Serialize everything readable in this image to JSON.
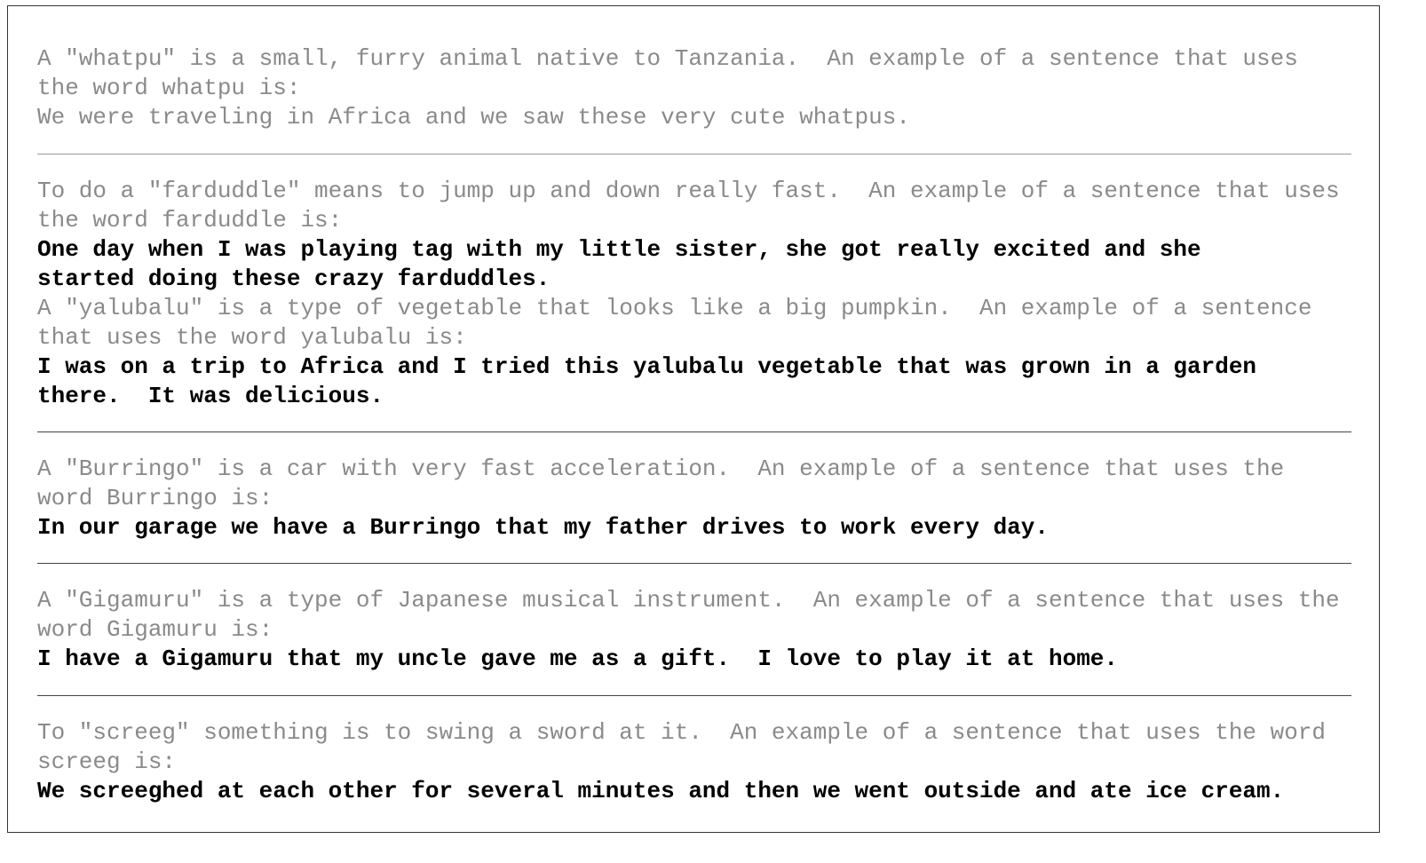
{
  "examples": [
    {
      "prompt_lines": [
        "A \"whatpu\" is a small, furry animal native to Tanzania.  An example of a sentence that uses",
        "the word whatpu is:",
        "We were traveling in Africa and we saw these very cute whatpus."
      ],
      "completion_lines": []
    },
    {
      "prompt_lines": [
        "To do a \"farduddle\" means to jump up and down really fast.  An example of a sentence that uses",
        "the word farduddle is:"
      ],
      "completion_lines": [
        "One day when I was playing tag with my little sister, she got really excited and she",
        "started doing these crazy farduddles."
      ],
      "prompt2_lines": [
        "A \"yalubalu\" is a type of vegetable that looks like a big pumpkin.  An example of a sentence",
        "that uses the word yalubalu is:"
      ],
      "completion2_lines": [
        "I was on a trip to Africa and I tried this yalubalu vegetable that was grown in a garden",
        "there.  It was delicious."
      ]
    },
    {
      "prompt_lines": [
        "A \"Burringo\" is a car with very fast acceleration.  An example of a sentence that uses the",
        "word Burringo is:"
      ],
      "completion_lines": [
        "In our garage we have a Burringo that my father drives to work every day."
      ]
    },
    {
      "prompt_lines": [
        "A \"Gigamuru\" is a type of Japanese musical instrument.  An example of a sentence that uses the",
        "word Gigamuru is:"
      ],
      "completion_lines": [
        "I have a Gigamuru that my uncle gave me as a gift.  I love to play it at home."
      ]
    },
    {
      "prompt_lines": [
        "To \"screeg\" something is to swing a sword at it.  An example of a sentence that uses the word",
        "screeg is:"
      ],
      "completion_lines": [
        "We screeghed at each other for several minutes and then we went outside and ate ice cream."
      ]
    }
  ]
}
